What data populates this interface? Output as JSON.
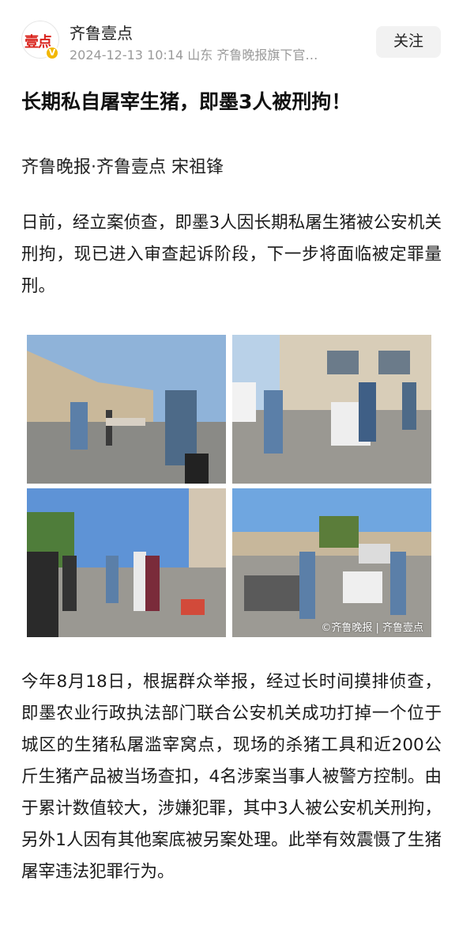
{
  "header": {
    "avatar_text": "壹点",
    "account_name": "齐鲁壹点",
    "meta": "2024-12-13  10:14  山东  齐鲁晚报旗下官…",
    "follow_label": "关注"
  },
  "article": {
    "title": "长期私自屠宰生猪，即墨3人被刑拘！",
    "byline": "齐鲁晚报·齐鲁壹点 宋祖锋",
    "paragraph_1": "日前，经立案侦查，即墨3人因长期私屠生猪被公安机关刑拘，现已进入审查起诉阶段，下一步将面临被定罪量刑。",
    "image_watermark": "©齐鲁晚报 | 齐鲁壹点",
    "paragraph_2": "今年8月18日，根据群众举报，经过长时间摸排侦查，即墨农业行政执法部门联合公安机关成功打掉一个位于城区的生猪私屠滥宰窝点，现场的杀猪工具和近200公斤生猪产品被当场查扣，4名涉案当事人被警方控制。由于累计数值较大，涉嫌犯罪，其中3人被公安机关刑拘，另外1人因有其他案底被另案处理。此举有效震慑了生猪屠宰违法犯罪行为。"
  },
  "colors": {
    "brand_red": "#d9231c",
    "verified_gold": "#f2b705",
    "meta_gray": "#9a9a9a",
    "button_bg": "#f2f2f2"
  }
}
